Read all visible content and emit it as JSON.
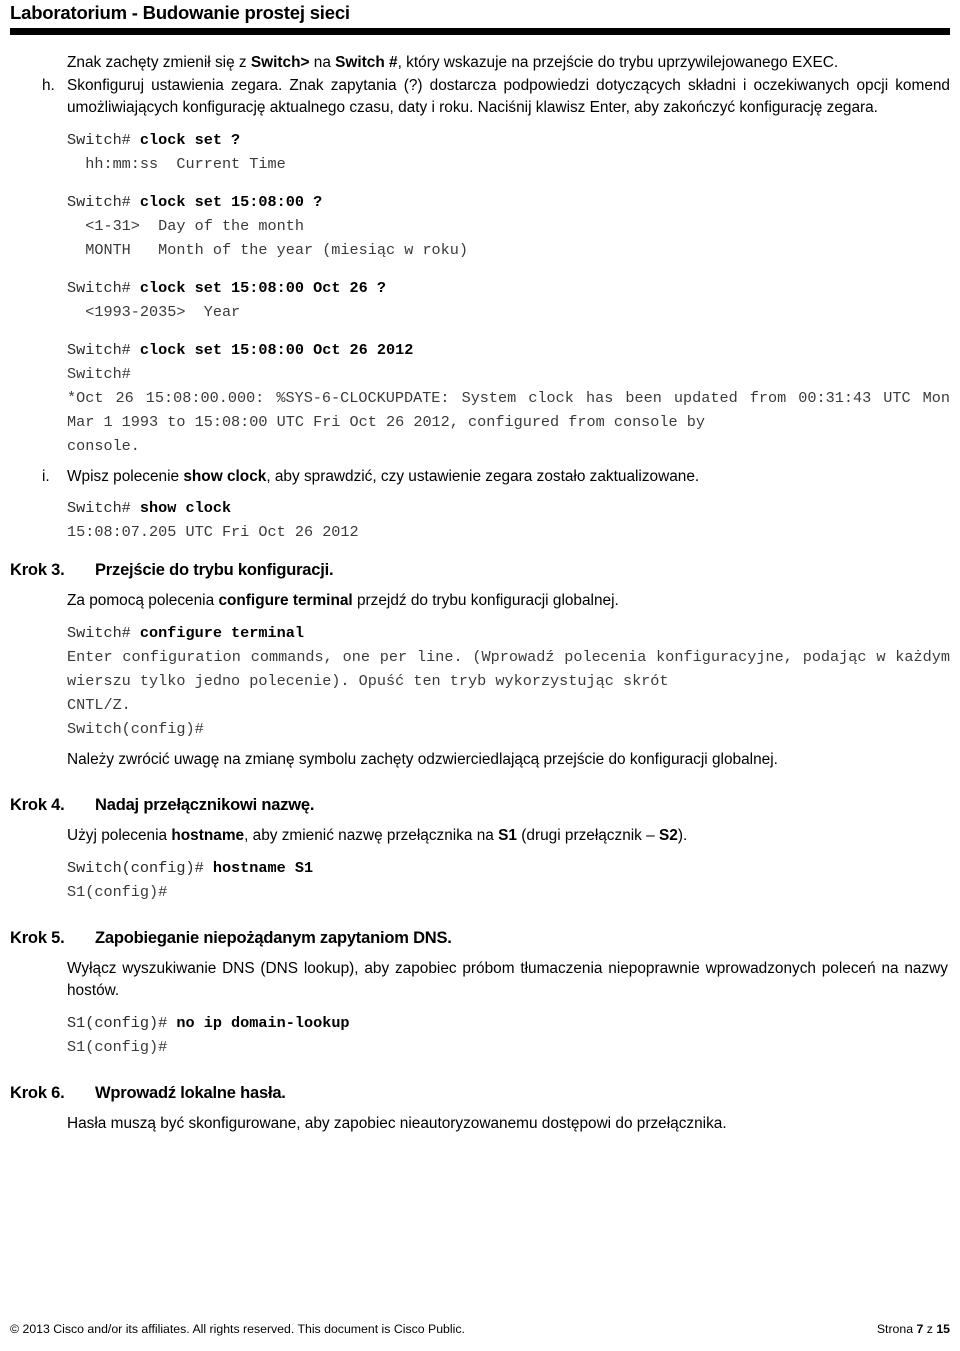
{
  "header": {
    "title": "Laboratorium - Budowanie prostej sieci"
  },
  "body": {
    "intro_para": {
      "p1": "Znak zachęty zmienił się z ",
      "b1": "Switch>",
      "p2": " na ",
      "b2": "Switch #",
      "p3": ", który wskazuje na przejście do trybu uprzywilejowanego EXEC."
    },
    "item_h": {
      "marker": "h.",
      "text": "Skonfiguruj ustawienia zegara. Znak zapytania (?) dostarcza podpowiedzi dotyczących składni i oczekiwanych opcji komend umożliwiających konfigurację aktualnego czasu, daty i roku. Naciśnij klawisz Enter, aby zakończyć konfigurację zegara."
    },
    "cli_clock_set_q": {
      "prompt": "Switch# ",
      "cmd": "clock set ?",
      "out1": "  hh:mm:ss  Current Time"
    },
    "cli_clock_set_time_q": {
      "prompt": "Switch# ",
      "cmd": "clock set 15:08:00 ?",
      "out1": "  <1-31>  Day of the month",
      "out2": "  MONTH   Month of the year (miesiąc w roku)"
    },
    "cli_clock_set_date_q": {
      "prompt": "Switch# ",
      "cmd": "clock set 15:08:00 Oct 26 ?",
      "out1": "  <1993-2035>  Year"
    },
    "cli_clock_set_full": {
      "prompt": "Switch# ",
      "cmd": "clock set 15:08:00 Oct 26 2012",
      "prompt2": "Switch#",
      "log_line1": "*Oct 26 15:08:00.000: %SYS-6-CLOCKUPDATE: System clock has been updated from 00:31:43 UTC Mon Mar 1 1993 to 15:08:00 UTC Fri Oct 26 2012, configured from console by",
      "log_line2": "console."
    },
    "item_i": {
      "marker": "i.",
      "p1": "Wpisz polecenie ",
      "b1": "show clock",
      "p2": ", aby sprawdzić, czy ustawienie zegara zostało zaktualizowane."
    },
    "cli_show_clock": {
      "prompt": "Switch# ",
      "cmd": "show clock",
      "out1": "15:08:07.205 UTC Fri Oct 26 2012"
    },
    "krok3": {
      "num": "Krok 3.",
      "title": "Przejście do trybu konfiguracji.",
      "p1": "Za pomocą polecenia ",
      "b1": "configure terminal",
      "p2": " przejdź do trybu konfiguracji globalnej."
    },
    "cli_configure_terminal": {
      "prompt": "Switch# ",
      "cmd": "configure terminal",
      "out_line1": "Enter configuration commands, one per line. (Wprowadź polecenia konfiguracyjne, podając w każdym wierszu tylko jedno polecenie). Opuść ten tryb wykorzystując skrót",
      "out_line2": "CNTL/Z.",
      "prompt2": "Switch(config)#"
    },
    "note_config_prompt": "Należy zwrócić uwagę na zmianę symbolu zachęty odzwierciedlającą przejście do konfiguracji globalnej.",
    "krok4": {
      "num": "Krok 4.",
      "title": "Nadaj przełącznikowi nazwę.",
      "p1": "Użyj polecenia ",
      "b1": "hostname",
      "p2": ", aby zmienić nazwę przełącznika na ",
      "b2": "S1",
      "p3": " (drugi przełącznik – ",
      "b3": "S2",
      "p4": ")."
    },
    "cli_hostname": {
      "prompt": "Switch(config)# ",
      "cmd": "hostname S1",
      "prompt2": "S1(config)#"
    },
    "krok5": {
      "num": "Krok 5.",
      "title": "Zapobieganie niepożądanym zapytaniom DNS.",
      "text": "Wyłącz wyszukiwanie DNS (DNS lookup), aby zapobiec próbom tłumaczenia niepoprawnie wprowadzonych poleceń na nazwy hostów."
    },
    "cli_no_ip_domain_lookup": {
      "prompt": "S1(config)# ",
      "cmd": "no ip domain-lookup",
      "prompt2": "S1(config)#"
    },
    "krok6": {
      "num": "Krok 6.",
      "title": "Wprowadź lokalne hasła.",
      "text": "Hasła muszą być skonfigurowane, aby zapobiec nieautoryzowanemu dostępowi do przełącznika."
    }
  },
  "footer": {
    "copyright": "© 2013 Cisco and/or its affiliates. All rights reserved. This document is Cisco Public.",
    "page_label_pre": "Strona ",
    "page_current": "7",
    "page_label_mid": " z ",
    "page_total": "15"
  }
}
